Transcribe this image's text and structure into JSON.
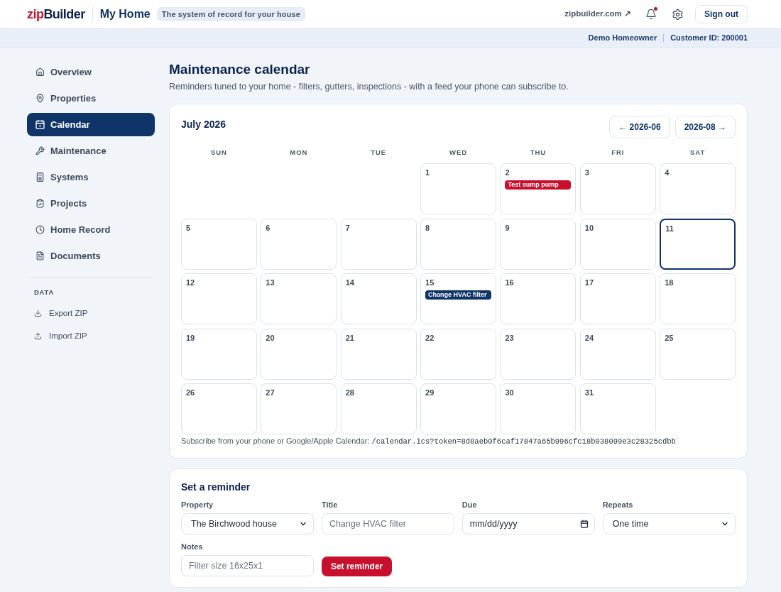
{
  "header": {
    "logo": {
      "prefix": "zip",
      "name": "Builder"
    },
    "app_title": "My Home",
    "tagline": "The system of record for your house",
    "site_link": "zipbuilder.com ↗",
    "notifications": {
      "unread": true
    },
    "sign_out": "Sign out"
  },
  "account_bar": {
    "user": "Demo Homeowner",
    "customer_id": "Customer ID: 200001"
  },
  "sidebar": {
    "items": [
      {
        "label": "Overview",
        "selected": false
      },
      {
        "label": "Properties",
        "selected": false
      },
      {
        "label": "Calendar",
        "selected": true
      },
      {
        "label": "Maintenance",
        "selected": false
      },
      {
        "label": "Systems",
        "selected": false
      },
      {
        "label": "Projects",
        "selected": false
      },
      {
        "label": "Home Record",
        "selected": false
      },
      {
        "label": "Documents",
        "selected": false
      }
    ],
    "data_section": {
      "title": "DATA",
      "items": [
        "Export ZIP",
        "Import ZIP"
      ]
    }
  },
  "page": {
    "title": "Maintenance calendar",
    "subtitle": "Reminders tuned to your home - filters, gutters, inspections - with a feed your phone can subscribe to."
  },
  "calendar": {
    "month": "July 2026",
    "prev": "← 2026-06",
    "next": "2026-08 →",
    "weekdays": [
      "SUN",
      "MON",
      "TUE",
      "WED",
      "THU",
      "FRI",
      "SAT"
    ],
    "weeks": [
      [
        {
          "kind": "blank"
        },
        {
          "kind": "blank"
        },
        {
          "kind": "blank"
        },
        {
          "kind": "day",
          "day": "1",
          "today": false
        },
        {
          "kind": "day",
          "day": "2",
          "today": false,
          "events": [
            {
              "label": "Test sump pump",
              "color": "#c8102e"
            }
          ]
        },
        {
          "kind": "day",
          "day": "3",
          "today": false
        },
        {
          "kind": "day",
          "day": "4",
          "today": false
        }
      ],
      [
        {
          "kind": "day",
          "day": "5",
          "today": false
        },
        {
          "kind": "day",
          "day": "6",
          "today": false
        },
        {
          "kind": "day",
          "day": "7",
          "today": false
        },
        {
          "kind": "day",
          "day": "8",
          "today": false
        },
        {
          "kind": "day",
          "day": "9",
          "today": false
        },
        {
          "kind": "day",
          "day": "10",
          "today": false
        },
        {
          "kind": "day",
          "day": "11",
          "today": true
        }
      ],
      [
        {
          "kind": "day",
          "day": "12",
          "today": false
        },
        {
          "kind": "day",
          "day": "13",
          "today": false
        },
        {
          "kind": "day",
          "day": "14",
          "today": false
        },
        {
          "kind": "day",
          "day": "15",
          "today": false,
          "events": [
            {
              "label": "Change HVAC filter",
              "color": "#0f3468"
            }
          ]
        },
        {
          "kind": "day",
          "day": "16",
          "today": false
        },
        {
          "kind": "day",
          "day": "17",
          "today": false
        },
        {
          "kind": "day",
          "day": "18",
          "today": false
        }
      ],
      [
        {
          "kind": "day",
          "day": "19",
          "today": false
        },
        {
          "kind": "day",
          "day": "20",
          "today": false
        },
        {
          "kind": "day",
          "day": "21",
          "today": false
        },
        {
          "kind": "day",
          "day": "22",
          "today": false
        },
        {
          "kind": "day",
          "day": "23",
          "today": false
        },
        {
          "kind": "day",
          "day": "24",
          "today": false
        },
        {
          "kind": "day",
          "day": "25",
          "today": false
        }
      ],
      [
        {
          "kind": "day",
          "day": "26",
          "today": false
        },
        {
          "kind": "day",
          "day": "27",
          "today": false
        },
        {
          "kind": "day",
          "day": "28",
          "today": false
        },
        {
          "kind": "day",
          "day": "29",
          "today": false
        },
        {
          "kind": "day",
          "day": "30",
          "today": false
        },
        {
          "kind": "day",
          "day": "31",
          "today": false
        },
        {
          "kind": "blank"
        }
      ]
    ],
    "subscribe": {
      "text": "Subscribe from your phone or Google/Apple Calendar:",
      "feed_url": "/calendar.ics?token=8d8aeb0f6caf17847a65b996cfc18b038099e3c28325cdbb"
    }
  },
  "reminder_form": {
    "title": "Set a reminder",
    "fields": [
      {
        "kind": "select",
        "label": "Property",
        "value": "The Birchwood house"
      },
      {
        "kind": "text",
        "label": "Title",
        "placeholder": "Change HVAC filter"
      },
      {
        "kind": "date",
        "label": "Due",
        "placeholder": "mm/dd/yyyy"
      },
      {
        "kind": "select",
        "label": "Repeats",
        "value": "One time"
      },
      {
        "kind": "text",
        "label": "Notes",
        "placeholder": "Filter size 16x25x1"
      }
    ],
    "submit": "Set reminder"
  }
}
